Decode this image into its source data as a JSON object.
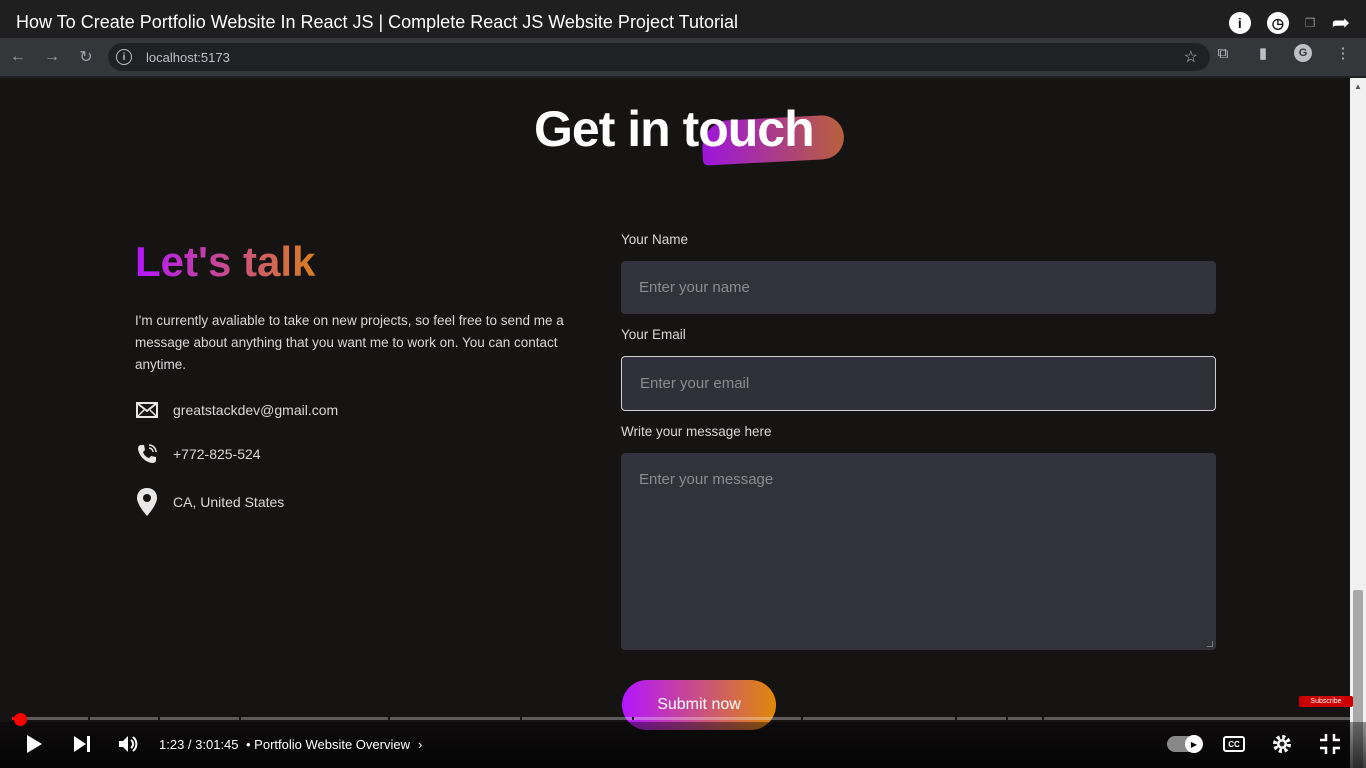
{
  "youtube": {
    "video_title": "How To Create Portfolio Website In React JS | Complete React JS Website Project Tutorial",
    "time": "1:23 / 3:01:45",
    "chapter": "• Portfolio Website Overview",
    "progress_percent": 0.8,
    "subscribe_label": "Subscribe",
    "cc_label": "CC"
  },
  "browser": {
    "url": "localhost:5173"
  },
  "page": {
    "heading": "Get in touch",
    "lets_talk": "Let's talk",
    "intro": "I'm currently avaliable to take on new projects, so feel free to send me a message about anything that you want me to work on. You can contact anytime.",
    "contacts": [
      {
        "icon": "mail-icon",
        "text": "greatstackdev@gmail.com"
      },
      {
        "icon": "phone-icon",
        "text": "+772-825-524"
      },
      {
        "icon": "location-icon",
        "text": "CA, United States"
      }
    ],
    "form": {
      "name_label": "Your Name",
      "name_placeholder": "Enter your name",
      "email_label": "Your Email",
      "email_placeholder": "Enter your email",
      "message_label": "Write your message here",
      "message_placeholder": "Enter your message",
      "submit_label": "Submit now"
    }
  },
  "colors": {
    "accent_start": "#b415ff",
    "accent_end": "#df8908",
    "background": "#161313",
    "input_bg": "#32323c",
    "progress": "#ff0000"
  }
}
